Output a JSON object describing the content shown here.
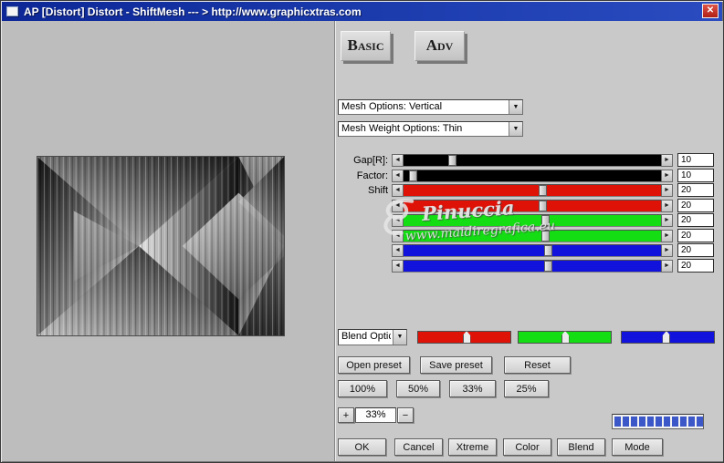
{
  "window": {
    "title": "AP [Distort]  Distort - ShiftMesh    --- > http://www.graphicxtras.com",
    "close_glyph": "✕"
  },
  "icons": {
    "dropdown_arrow": "▼",
    "slider_left": "◄",
    "slider_right": "►"
  },
  "tabs": {
    "basic_label": "Basic",
    "adv_label": "Adv"
  },
  "selects": {
    "mesh_options_value": "Mesh Options: Vertical",
    "mesh_weight_value": "Mesh Weight Options: Thin",
    "blend_value": "Blend Optic"
  },
  "sliders": {
    "rows": [
      {
        "label": "Gap[R]:",
        "value": "10",
        "track_color": "#000000",
        "thumb_pct": 19
      },
      {
        "label": "Factor:",
        "value": "10",
        "track_color": "#000000",
        "thumb_pct": 4
      },
      {
        "label": "Shift",
        "value": "20",
        "track_color": "#df1208",
        "thumb_pct": 54
      },
      {
        "label": "",
        "value": "20",
        "track_color": "#df1208",
        "thumb_pct": 54
      },
      {
        "label": "",
        "value": "20",
        "track_color": "#14dd14",
        "thumb_pct": 55
      },
      {
        "label": "",
        "value": "20",
        "track_color": "#14dd14",
        "thumb_pct": 55
      },
      {
        "label": "",
        "value": "20",
        "track_color": "#1212dd",
        "thumb_pct": 56
      },
      {
        "label": "",
        "value": "20",
        "track_color": "#1212dd",
        "thumb_pct": 56
      }
    ]
  },
  "blend_bars": [
    {
      "color": "#df1208",
      "pointer_pct": 52
    },
    {
      "color": "#14dd14",
      "pointer_pct": 50
    },
    {
      "color": "#1212dd",
      "pointer_pct": 48
    }
  ],
  "watermark": {
    "name": "Pinuccia",
    "site": "www.maidiregrafica.eu"
  },
  "preset_buttons": {
    "open": "Open preset",
    "save": "Save preset",
    "reset": "Reset"
  },
  "zoom_buttons": [
    "100%",
    "50%",
    "33%",
    "25%"
  ],
  "zoom_control": {
    "plus": "+",
    "value": "33%",
    "minus": "−"
  },
  "bottom_buttons": [
    "OK",
    "Cancel",
    "Xtreme",
    "Color",
    "Blend",
    "Mode"
  ],
  "progress": {
    "segments": 11,
    "color": "#3b57c8"
  }
}
